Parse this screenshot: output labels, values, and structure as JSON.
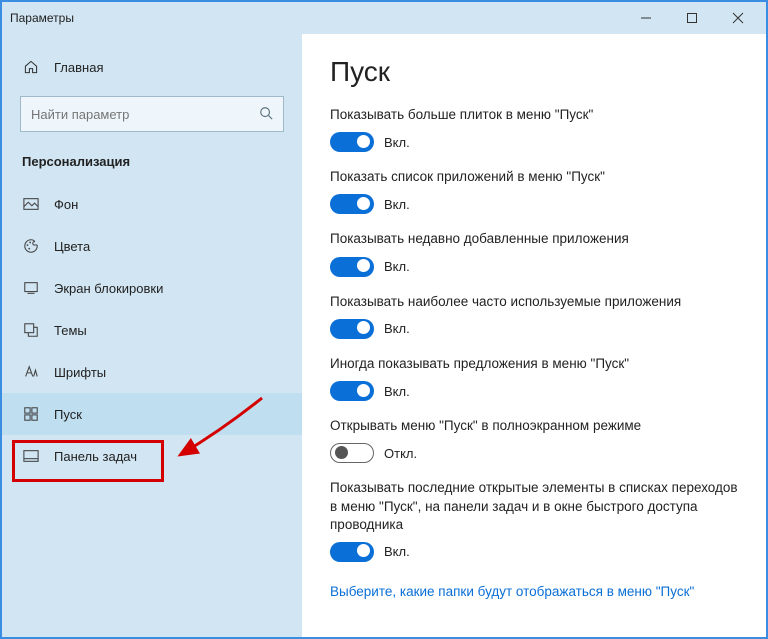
{
  "titlebar": {
    "title": "Параметры"
  },
  "sidebar": {
    "home": "Главная",
    "search_placeholder": "Найти параметр",
    "category": "Персонализация",
    "items": [
      {
        "label": "Фон"
      },
      {
        "label": "Цвета"
      },
      {
        "label": "Экран блокировки"
      },
      {
        "label": "Темы"
      },
      {
        "label": "Шрифты"
      },
      {
        "label": "Пуск"
      },
      {
        "label": "Панель задач"
      }
    ]
  },
  "main": {
    "heading": "Пуск",
    "on_label": "Вкл.",
    "off_label": "Откл.",
    "settings": [
      {
        "label": "Показывать больше плиток в меню \"Пуск\"",
        "state": "on"
      },
      {
        "label": "Показать список приложений в меню \"Пуск\"",
        "state": "on"
      },
      {
        "label": "Показывать недавно добавленные приложения",
        "state": "on"
      },
      {
        "label": "Показывать наиболее часто используемые приложения",
        "state": "on"
      },
      {
        "label": "Иногда показывать предложения в меню \"Пуск\"",
        "state": "on"
      },
      {
        "label": "Открывать меню \"Пуск\" в полноэкранном режиме",
        "state": "off"
      },
      {
        "label": "Показывать последние открытые элементы в списках переходов в меню \"Пуск\", на панели задач и в окне быстрого доступа проводника",
        "state": "on"
      }
    ],
    "link": "Выберите, какие папки будут отображаться в меню \"Пуск\""
  }
}
